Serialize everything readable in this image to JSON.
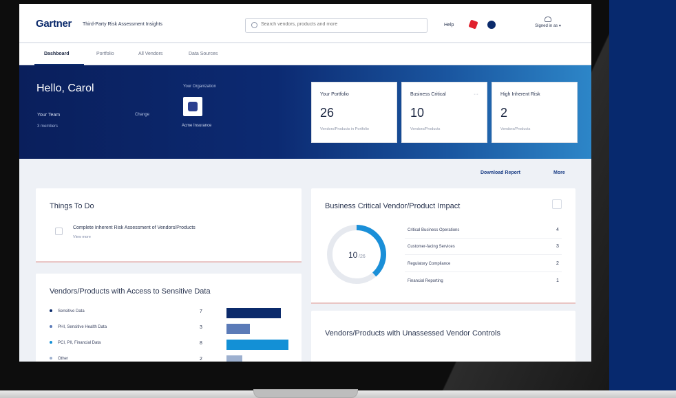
{
  "header": {
    "logo": "Gartner",
    "product": "Third-Party Risk Assessment Insights",
    "search_placeholder": "Search vendors, products and more",
    "help": "Help",
    "user": "Signed in as ▾"
  },
  "tabs": [
    {
      "label": "Dashboard",
      "active": true
    },
    {
      "label": "Portfolio",
      "active": false
    },
    {
      "label": "All Vendors",
      "active": false
    },
    {
      "label": "Data Sources",
      "active": false
    }
  ],
  "hero": {
    "greeting": "Hello, Carol",
    "team_label": "Your Team",
    "team_action": "Change",
    "team_sub": "3 members",
    "org_label": "Your Organization",
    "org_name": "Acme Insurance"
  },
  "stats": [
    {
      "title": "Your Portfolio",
      "value": "26",
      "sub": "Vendors/Products in Portfolio",
      "menu": ""
    },
    {
      "title": "Business Critical",
      "value": "10",
      "sub": "Vendors/Products",
      "menu": "···"
    },
    {
      "title": "High Inherent Risk",
      "value": "2",
      "sub": "Vendors/Products",
      "menu": ""
    }
  ],
  "links": {
    "download": "Download Report",
    "more": "More"
  },
  "things_to_do": {
    "title": "Things To Do",
    "item": "Complete Inherent Risk Assessment of Vendors/Products",
    "item_sub": "View more"
  },
  "sensitive_data": {
    "title": "Vendors/Products with Access to Sensitive Data",
    "rows": [
      {
        "label": "Sensitive Data",
        "count": "7",
        "value": 7,
        "color": "#0b2a6b"
      },
      {
        "label": "PHI, Sensitive Health Data",
        "count": "3",
        "value": 3,
        "color": "#5b7bb8"
      },
      {
        "label": "PCI, PII, Financial Data",
        "count": "8",
        "value": 8,
        "color": "#1390d6"
      },
      {
        "label": "Other",
        "count": "2",
        "value": 2,
        "color": "#9db0cf"
      }
    ]
  },
  "impact": {
    "title": "Business Critical Vendor/Product Impact",
    "donut_label": "10",
    "donut_unit": "/26",
    "donut_fraction": 0.385,
    "rows": [
      {
        "label": "Critical Business Operations",
        "count": "4"
      },
      {
        "label": "Customer-facing Services",
        "count": "3"
      },
      {
        "label": "Regulatory Compliance",
        "count": "2"
      },
      {
        "label": "Financial Reporting",
        "count": "1"
      }
    ]
  },
  "unassessed": {
    "title": "Vendors/Products with Unassessed Vendor Controls"
  }
}
